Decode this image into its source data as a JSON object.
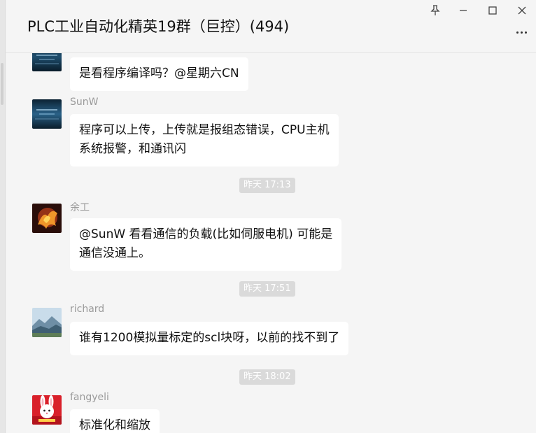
{
  "window": {
    "title": "PLC工业自动化精英19群（巨控）(494)",
    "controls": {
      "pin_icon": "pin-icon",
      "minimize_icon": "minimize-icon",
      "maximize_icon": "maximize-icon",
      "close_icon": "close-icon",
      "more_icon": "more-icon"
    }
  },
  "messages": [
    {
      "sender": "",
      "lines": [
        "是看程序编译吗？@星期六CN"
      ],
      "avatar": "night-sea-avatar"
    },
    {
      "sender": "SunW",
      "lines": [
        "程序可以上传，上传就是报组态错误，CPU主机",
        "系统报警，和通讯闪"
      ],
      "avatar": "night-sea-avatar"
    },
    {
      "sender": "余工",
      "lines": [
        "@SunW 看看通信的负载(比如伺服电机) 可能是",
        "通信没通上。"
      ],
      "avatar": "phoenix-avatar"
    },
    {
      "sender": "richard",
      "lines": [
        "谁有1200模拟量标定的scl块呀，以前的找不到了"
      ],
      "avatar": "mountain-avatar"
    },
    {
      "sender": "fangyeli",
      "lines": [
        "标准化和缩放"
      ],
      "avatar": "rabbit-avatar"
    }
  ],
  "timestamps": [
    "昨天 17:13",
    "昨天 17:51",
    "昨天 18:02"
  ],
  "colors": {
    "background": "#f5f5f5",
    "bubble": "#ffffff",
    "timestamp_bg": "#dadada",
    "sender_text": "#9a9a9a"
  }
}
